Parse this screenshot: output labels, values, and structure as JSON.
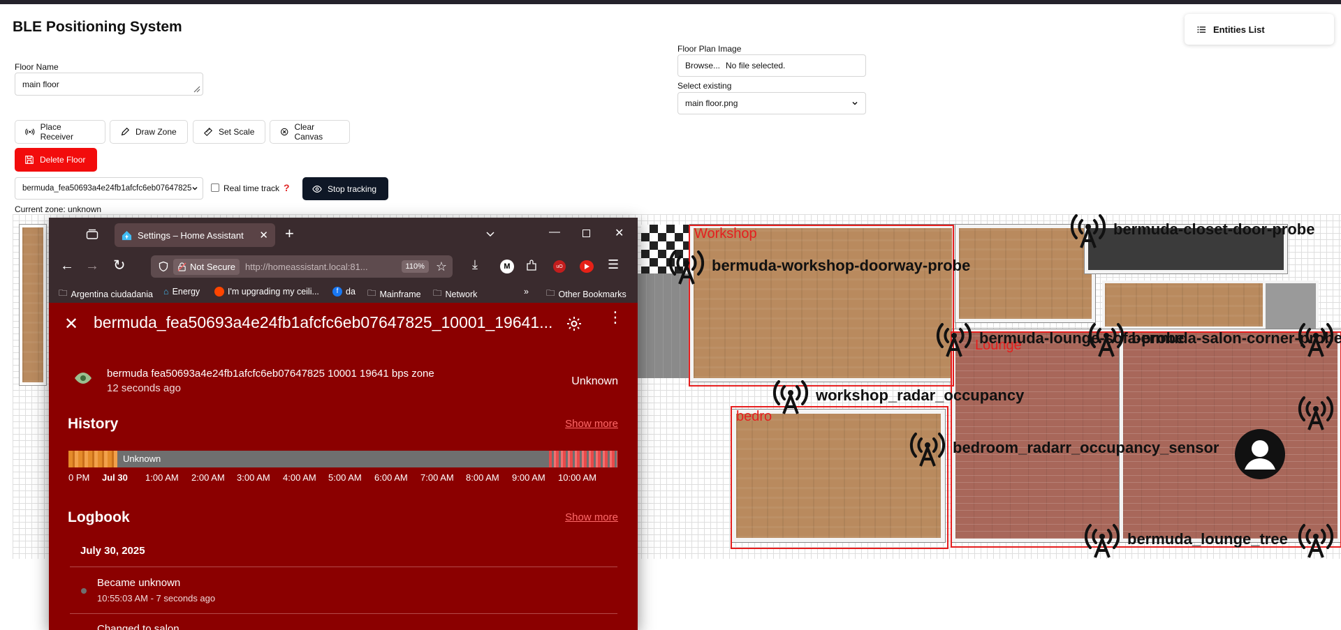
{
  "app": {
    "title": "BLE Positioning System",
    "floor_name_label": "Floor Name",
    "floor_name_value": "main floor",
    "floor_plan_label": "Floor Plan Image",
    "browse_label": "Browse...",
    "no_file_label": "No file selected.",
    "select_existing_label": "Select existing",
    "select_existing_value": "main floor.png",
    "entities_list_label": "Entities List",
    "toolbar": {
      "place_receiver": "Place Receiver",
      "draw_zone": "Draw Zone",
      "set_scale": "Set Scale",
      "clear_canvas": "Clear Canvas",
      "delete_floor": "Delete Floor"
    },
    "device_select_value": "bermuda_fea50693a4e24fb1afcfc6eb07647825",
    "real_time_track_label": "Real time track",
    "help_icon": "?",
    "stop_tracking_label": "Stop tracking",
    "current_zone_label": "Current zone:",
    "current_zone_value": "unknown"
  },
  "canvas": {
    "zones": [
      {
        "label": "Workshop"
      },
      {
        "label": "Lounge"
      },
      {
        "label": "bedro"
      }
    ],
    "probes": [
      {
        "label": "bermuda-closet-door-probe"
      },
      {
        "label": "bermuda-workshop-doorway-probe"
      },
      {
        "label": "bermuda-lounge-sofa-probe"
      },
      {
        "label": "bermuda-salon-corner-probe"
      },
      {
        "label": "workshop_radar_occupancy"
      },
      {
        "label": "bedroom_radarr_occupancy_sensor"
      },
      {
        "label": "bermuda_lounge_tree"
      }
    ],
    "person_icon": "person-marker-icon"
  },
  "browser": {
    "tab_title": "Settings – Home Assistant",
    "not_secure_label": "Not Secure",
    "url": "http://homeassistant.local:81...",
    "zoom": "110%",
    "bookmarks": [
      {
        "label": "Argentina ciudadania",
        "icon": "folder-icon"
      },
      {
        "label": "Energy",
        "icon": "home-assistant-icon"
      },
      {
        "label": "I'm upgrading my ceili...",
        "icon": "reddit-icon"
      },
      {
        "label": "da",
        "icon": "facebook-icon"
      },
      {
        "label": "Mainframe",
        "icon": "folder-icon"
      },
      {
        "label": "Network",
        "icon": "folder-icon"
      }
    ],
    "other_bookmarks": "Other Bookmarks"
  },
  "dialog": {
    "title": "bermuda_fea50693a4e24fb1afcfc6eb07647825_10001_19641...",
    "entity_name": "bermuda fea50693a4e24fb1afcfc6eb07647825 10001 19641 bps zone",
    "entity_time": "12 seconds ago",
    "entity_state": "Unknown",
    "history_heading": "History",
    "show_more": "Show more",
    "history_bar_label": "Unknown",
    "time_ticks": [
      "0 PM",
      "Jul 30",
      "1:00 AM",
      "2:00 AM",
      "3:00 AM",
      "4:00 AM",
      "5:00 AM",
      "6:00 AM",
      "7:00 AM",
      "8:00 AM",
      "9:00 AM",
      "10:00 AM"
    ],
    "logbook_heading": "Logbook",
    "log_date": "July 30, 2025",
    "log_entries": [
      {
        "title": "Became unknown",
        "time": "10:55:03 AM - 7 seconds ago"
      },
      {
        "title": "Changed to salon",
        "time": ""
      }
    ]
  },
  "colors": {
    "accent_red": "#f20c0c",
    "dark_button": "#0e1726",
    "dialog_bg": "#8b0000",
    "zone_stroke": "#e51e1e"
  }
}
